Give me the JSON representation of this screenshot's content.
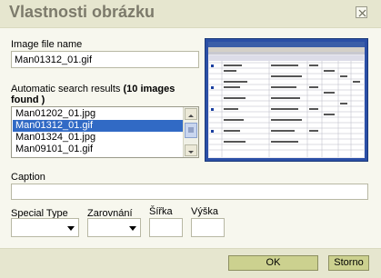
{
  "dialog": {
    "title": "Vlastnosti obrázku",
    "close_glyph": "⊠"
  },
  "image_file": {
    "label": "Image file name",
    "value": "Man01312_01.gif"
  },
  "search": {
    "label_prefix": "Automatic search results ",
    "label_bold_line1": "(10 images",
    "label_bold_line2": "found )",
    "results": [
      "Man01202_01.jpg",
      "Man01312_01.gif",
      "Man01324_01.jpg",
      "Man09101_01.gif"
    ],
    "selected_index": 1
  },
  "preview": {
    "accent": "#2b4fa6"
  },
  "caption": {
    "label": "Caption",
    "value": ""
  },
  "options": {
    "special_type_label": "Special Type",
    "align_label": "Zarovnání",
    "width_label": "Šířka",
    "height_label": "Výška",
    "special_type_value": "",
    "align_value": "",
    "width_value": "",
    "height_value": ""
  },
  "footer": {
    "ok_label": "OK",
    "cancel_label": "Storno",
    "button_color": "#ccd18f"
  }
}
